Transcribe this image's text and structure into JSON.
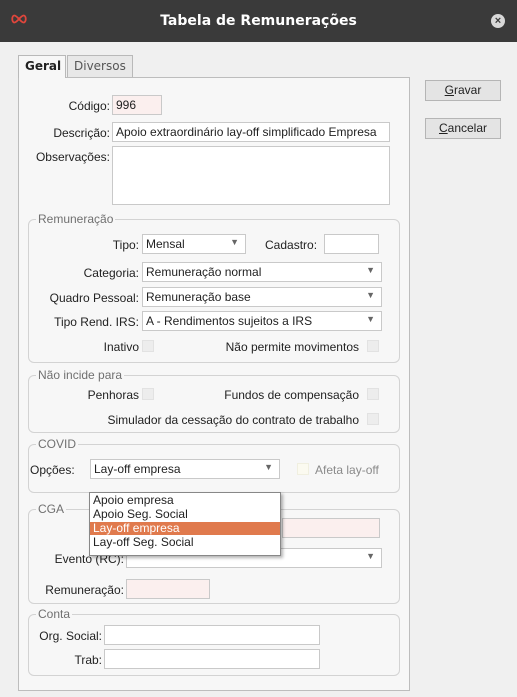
{
  "window": {
    "title": "Tabela de Remunerações",
    "close_glyph": "×"
  },
  "tabs": [
    {
      "label": "Geral",
      "active": true
    },
    {
      "label": "Diversos",
      "active": false
    }
  ],
  "buttons": {
    "save_label": "Gravar",
    "save_accel": "G",
    "save_rest": "ravar",
    "cancel_label": "Cancelar",
    "cancel_accel": "C",
    "cancel_rest": "ancelar"
  },
  "header": {
    "codigo_label": "Código:",
    "codigo_value": "996",
    "descricao_label": "Descrição:",
    "descricao_value": "Apoio extraordinário lay-off simplificado Empresa",
    "observacoes_label": "Observações:",
    "observacoes_value": ""
  },
  "remuneracao": {
    "title": "Remuneração",
    "tipo_label": "Tipo:",
    "tipo_value": "Mensal",
    "cadastro_label": "Cadastro:",
    "cadastro_value": "",
    "categoria_label": "Categoria:",
    "categoria_value": "Remuneração normal",
    "quadro_label": "Quadro Pessoal:",
    "quadro_value": "Remuneração base",
    "irs_label": "Tipo Rend. IRS:",
    "irs_value": "A - Rendimentos sujeitos a IRS",
    "inativo_label": "Inativo",
    "nao_permite_label": "Não permite movimentos"
  },
  "nao_incide": {
    "title": "Não incide para",
    "penhoras_label": "Penhoras",
    "fundos_label": "Fundos de compensação",
    "simulador_label": "Simulador da cessação do contrato de trabalho"
  },
  "covid": {
    "title": "COVID",
    "opcoes_label": "Opções:",
    "opcoes_value": "Lay-off empresa",
    "afeta_label": "Afeta lay-off",
    "options": [
      "Apoio empresa",
      "Apoio Seg. Social",
      "Lay-off empresa",
      "Lay-off Seg. Social"
    ],
    "selected_index": 2
  },
  "cga": {
    "title": "CGA",
    "evento_label": "Evento (RC):",
    "evento_value": "",
    "remuneracao_label": "Remuneração:",
    "remuneracao_value": ""
  },
  "conta": {
    "title": "Conta",
    "org_label": "Org. Social:",
    "org_value": "",
    "trab_label": "Trab:",
    "trab_value": ""
  },
  "colors": {
    "titlebar": "#3a3a3a",
    "logo": "#e0463c",
    "selection": "#e07a4d",
    "required_field": "#fbefee"
  },
  "icons": {
    "logo": "infinity-icon",
    "close": "close-icon",
    "dropdown": "chevron-down-icon"
  }
}
